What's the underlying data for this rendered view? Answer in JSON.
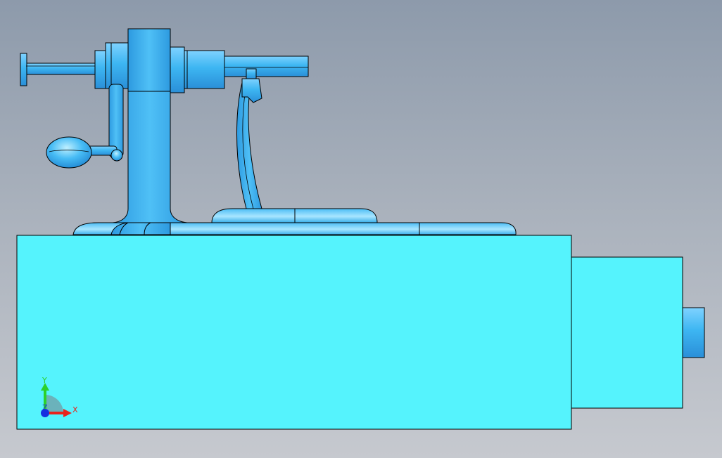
{
  "viewport": {
    "background_top": "#8d9aab",
    "background_bottom": "#c6c9cf"
  },
  "model": {
    "base_color": "#55f3fd",
    "part_color": "#3db6f2",
    "part_highlight": "#9fe2ff",
    "edge_color": "#000000"
  },
  "triad": {
    "x_label": "X",
    "y_label": "Y",
    "z_label": "Z",
    "x_color": "#e8241c",
    "y_color": "#2bd12b",
    "z_color": "#1530e0"
  }
}
